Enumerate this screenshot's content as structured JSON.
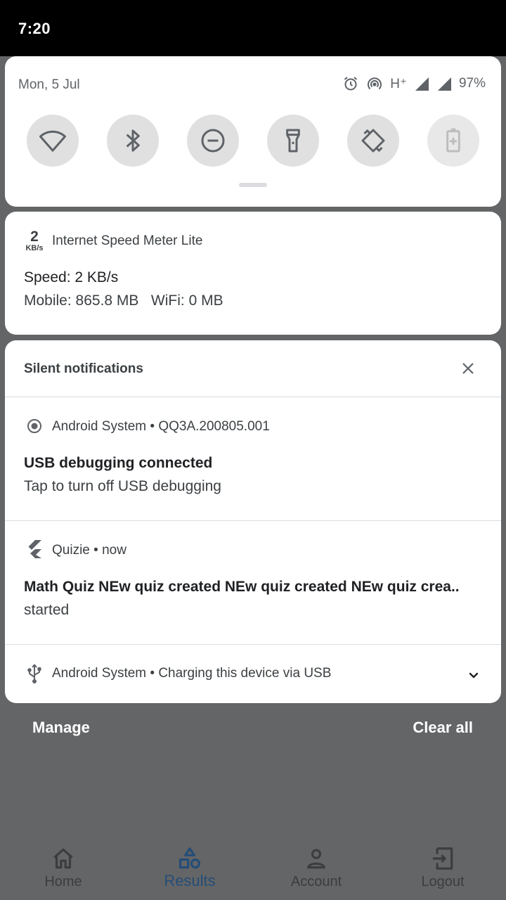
{
  "status_bar": {
    "time": "7:20"
  },
  "quick_settings": {
    "date": "Mon, 5 Jul",
    "network_type": "H⁺",
    "battery_percent": "97%",
    "tiles": [
      {
        "icon": "wifi-icon",
        "enabled": true
      },
      {
        "icon": "bluetooth-icon",
        "enabled": true
      },
      {
        "icon": "do-not-disturb-icon",
        "enabled": true
      },
      {
        "icon": "flashlight-icon",
        "enabled": true
      },
      {
        "icon": "auto-rotate-icon",
        "enabled": true
      },
      {
        "icon": "battery-saver-icon",
        "enabled": false
      }
    ]
  },
  "speed_notification": {
    "icon_value": "2",
    "icon_unit": "KB/s",
    "app_name": "Internet Speed Meter Lite",
    "title": "Speed: 2 KB/s",
    "text": "Mobile: 865.8 MB   WiFi: 0 MB"
  },
  "silent_section": {
    "title": "Silent notifications",
    "notifications": [
      {
        "icon": "android-system-icon",
        "header": "Android System • QQ3A.200805.001",
        "title": "USB debugging connected",
        "text": "Tap to turn off USB debugging"
      },
      {
        "icon": "flutter-icon",
        "header": "Quizie • now",
        "title": "Math Quiz  NEw quiz created NEw quiz created NEw quiz crea..",
        "text": "started"
      },
      {
        "icon": "usb-icon",
        "header": "Android System • Charging this device via USB"
      }
    ]
  },
  "actions": {
    "manage": "Manage",
    "clear_all": "Clear all"
  },
  "bottom_nav": {
    "items": [
      {
        "label": "Home",
        "icon": "home-icon",
        "active": false
      },
      {
        "label": "Results",
        "icon": "shapes-icon",
        "active": true
      },
      {
        "label": "Account",
        "icon": "person-icon",
        "active": false
      },
      {
        "label": "Logout",
        "icon": "logout-icon",
        "active": false
      }
    ]
  },
  "colors": {
    "scrim": "#646566",
    "active_nav": "#244d78",
    "card_background": "#ffffff"
  }
}
